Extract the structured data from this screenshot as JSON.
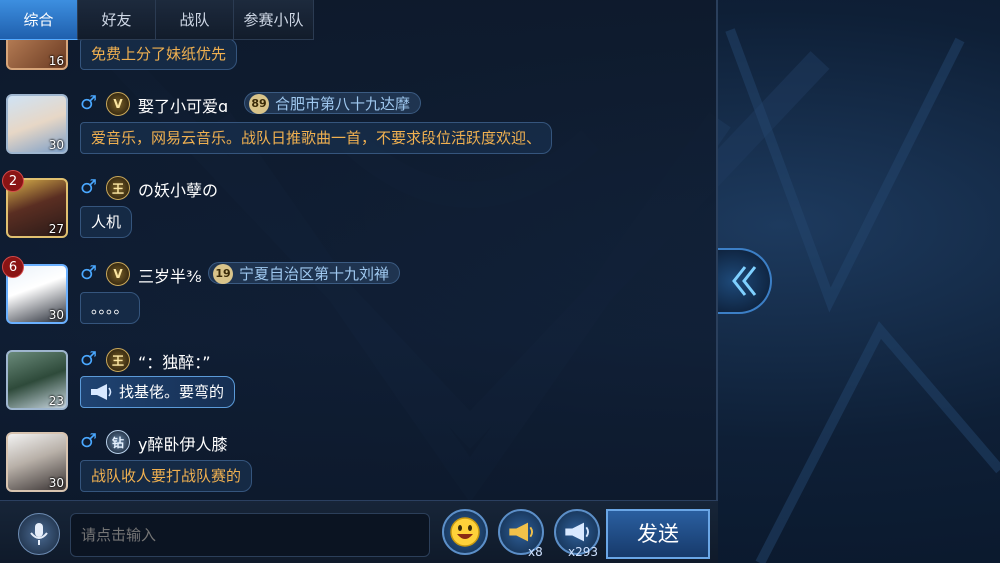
{
  "tabs": [
    {
      "label": "综合",
      "active": true
    },
    {
      "label": "好友",
      "active": false
    },
    {
      "label": "战队",
      "active": false
    },
    {
      "label": "参赛小队",
      "active": false
    }
  ],
  "messages": [
    {
      "level": "16",
      "text": "免费上分了妹纸优先"
    },
    {
      "level": "30",
      "gender": "♂",
      "tier": "V",
      "name": "娶了小可爱ɑ",
      "squad_num": "89",
      "squad": "合肥市第八十九达摩",
      "text": "爱音乐，网易云音乐。战队日推歌曲一首，不要求段位活跃度欢迎、"
    },
    {
      "level": "27",
      "rank": "2",
      "gender": "♂",
      "tier": "王",
      "name": "の妖小孽の",
      "text": "人机"
    },
    {
      "level": "30",
      "rank": "6",
      "gender": "♂",
      "tier": "V",
      "name": "三岁半⅜",
      "squad_num": "19",
      "squad": "宁夏自治区第十九刘禅",
      "text": "。。。。"
    },
    {
      "level": "23",
      "gender": "♂",
      "tier": "王",
      "name": "“：独醉：”",
      "text": "找基佬。要弯的"
    },
    {
      "level": "30",
      "gender": "♂",
      "tier": "钻",
      "name": "y醉卧伊人膝",
      "text": "战队收人要打战队赛的"
    }
  ],
  "input": {
    "placeholder": "请点击输入"
  },
  "horn_small": {
    "count": "x8"
  },
  "horn_big": {
    "count": "x293"
  },
  "send_label": "发送",
  "icons": {
    "voice": "microphone-icon",
    "emoji": "emoji-icon",
    "horn": "megaphone-icon",
    "collapse": "double-chevron-left-icon"
  },
  "colors": {
    "accent": "#3d8fe0",
    "message_text": "#f0b050",
    "gender": "#4aa8ff"
  }
}
